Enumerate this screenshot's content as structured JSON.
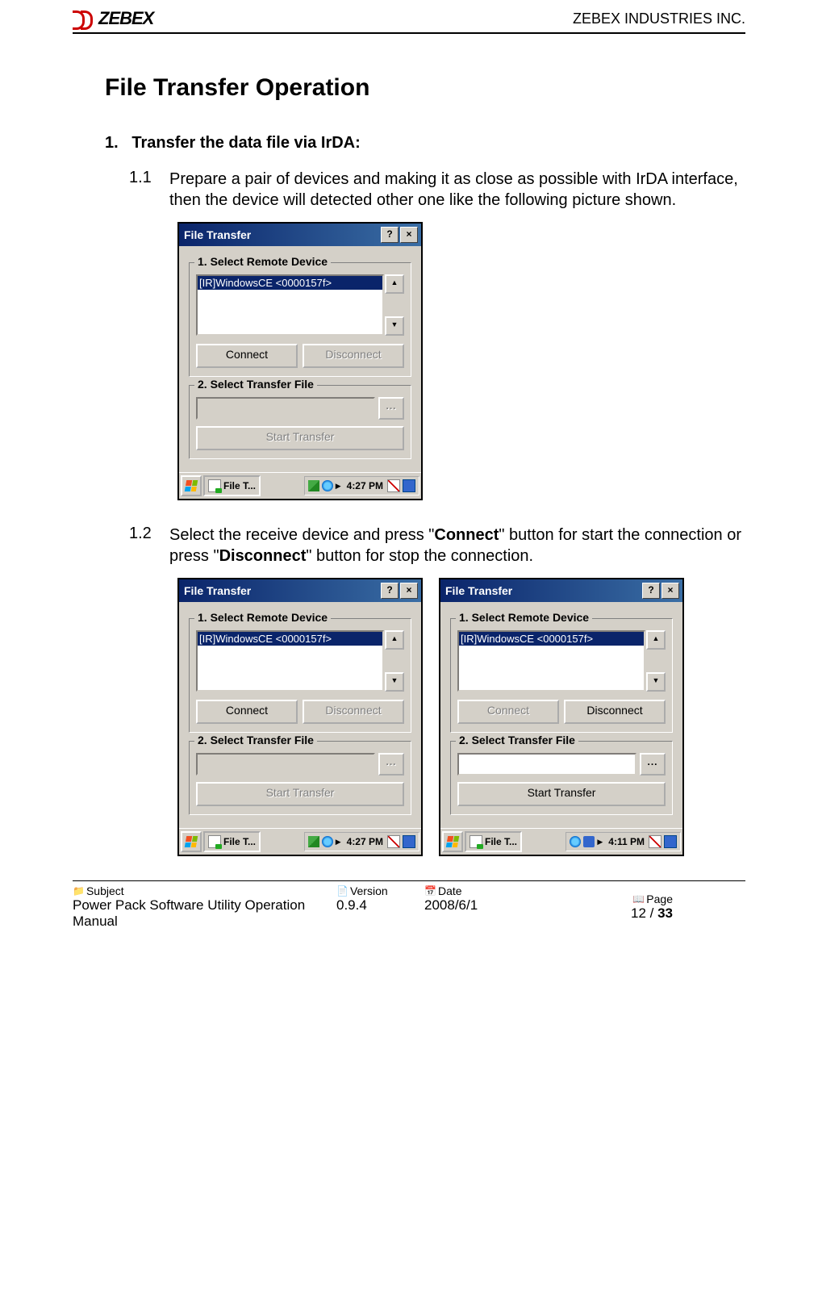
{
  "header": {
    "logo_text": "ZEBEX",
    "company": "ZEBEX INDUSTRIES INC."
  },
  "title": "File Transfer Operation",
  "step1": {
    "num": "1.",
    "text": "Transfer the data file via IrDA:"
  },
  "sub11": {
    "num": "1.1",
    "text": "Prepare a pair of devices and making it as close as possible with IrDA interface, then the device will detected other one like the following picture shown."
  },
  "sub12": {
    "num": "1.2",
    "pre": "Select the receive device and press \"",
    "b1": "Connect",
    "mid": "\" button for start the connection or press \"",
    "b2": "Disconnect",
    "post": "\" button for stop the connection."
  },
  "dialog": {
    "title": "File Transfer",
    "help": "?",
    "close": "×",
    "group1": "1. Select Remote Device",
    "device": "[IR]WindowsCE <0000157f>",
    "connect": "Connect",
    "disconnect": "Disconnect",
    "group2": "2. Select Transfer File",
    "browse": "...",
    "start": "Start Transfer",
    "task": "File T...",
    "time1": "4:27 PM",
    "time2": "4:11 PM"
  },
  "footer": {
    "subject_label": "Subject",
    "subject": "Power Pack Software Utility Operation Manual",
    "version_label": "Version",
    "version": "0.9.4",
    "date_label": "Date",
    "date": "2008/6/1",
    "page_label": "Page",
    "page_cur": "12",
    "page_sep": " / ",
    "page_total": "33"
  }
}
